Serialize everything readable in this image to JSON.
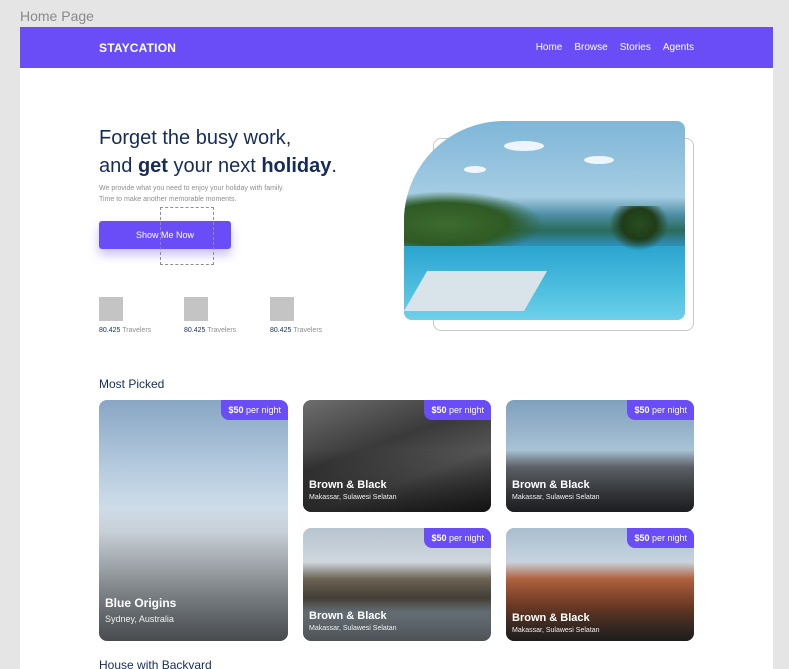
{
  "frame_label": "Home Page",
  "nav": {
    "brand": "STAYCATION",
    "links": [
      "Home",
      "Browse",
      "Stories",
      "Agents"
    ]
  },
  "hero": {
    "title_line1": "Forget the busy work,",
    "title_and": "and ",
    "title_get": "get",
    "title_mid": " your next ",
    "title_holiday": "holiday",
    "title_end": ".",
    "desc_line1": "We provide what you need to enjoy your holiday with family.",
    "desc_line2": "Time to make another memorable moments.",
    "cta_label": "Show Me Now"
  },
  "stats": [
    {
      "value": "80.425",
      "label": " Travelers"
    },
    {
      "value": "80.425",
      "label": " Travelers"
    },
    {
      "value": "80.425",
      "label": " Travelers"
    }
  ],
  "most_picked": {
    "title": "Most Picked",
    "cards": [
      {
        "price": "$50",
        "unit": " per night",
        "name": "Blue Origins",
        "location": "Sydney, Australia"
      },
      {
        "price": "$50",
        "unit": " per night",
        "name": "Brown & Black",
        "location": "Makassar, Sulawesi Selatan"
      },
      {
        "price": "$50",
        "unit": " per night",
        "name": "Brown & Black",
        "location": "Makassar, Sulawesi Selatan"
      },
      {
        "price": "$50",
        "unit": " per night",
        "name": "Brown & Black",
        "location": "Makassar, Sulawesi Selatan"
      },
      {
        "price": "$50",
        "unit": " per night",
        "name": "Brown & Black",
        "location": "Makassar, Sulawesi Selatan"
      }
    ]
  },
  "next_section_title": "House with Backyard",
  "colors": {
    "accent": "#6a4df7",
    "heading": "#152c5b",
    "muted": "#8f8f8f"
  }
}
